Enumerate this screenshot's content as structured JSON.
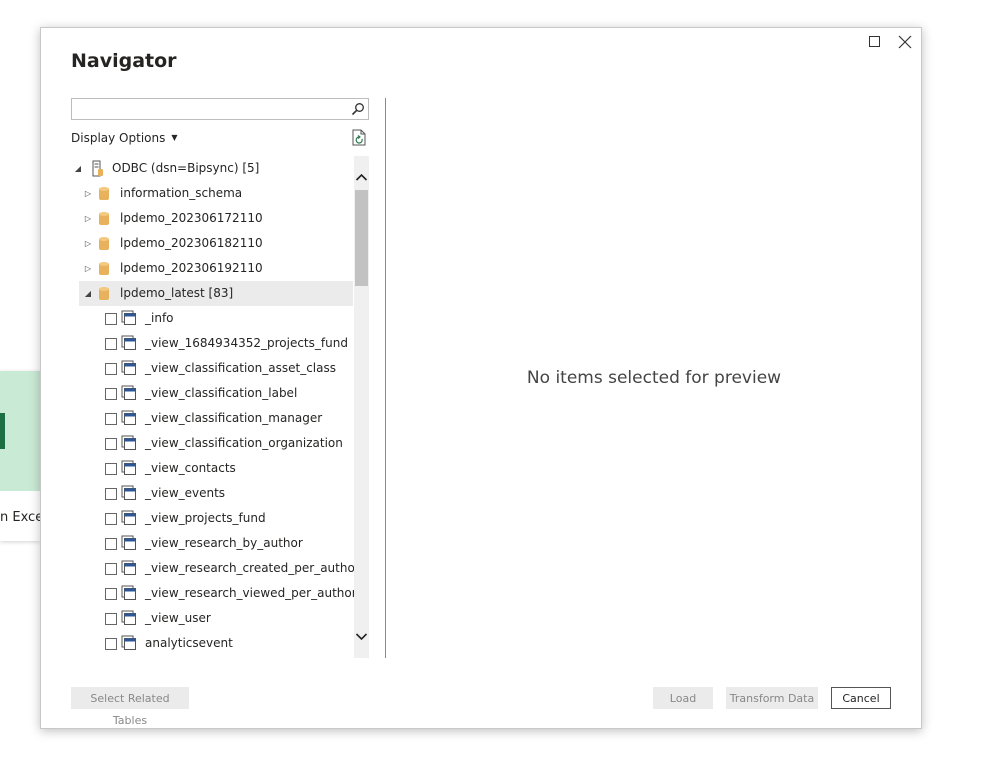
{
  "background": {
    "card_label": "n Excel"
  },
  "dialog": {
    "title": "Navigator",
    "search": {
      "value": "",
      "placeholder": ""
    },
    "display_options_label": "Display Options",
    "preview_empty_text": "No items selected for preview",
    "buttons": {
      "select_related": "Select Related Tables",
      "load": "Load",
      "transform": "Transform Data",
      "cancel": "Cancel"
    }
  },
  "tree": {
    "root": {
      "label": "ODBC (dsn=Bipsync) [5]",
      "expanded": true
    },
    "databases": [
      {
        "label": "information_schema",
        "expanded": false
      },
      {
        "label": "lpdemo_202306172110",
        "expanded": false
      },
      {
        "label": "lpdemo_202306182110",
        "expanded": false
      },
      {
        "label": "lpdemo_202306192110",
        "expanded": false
      },
      {
        "label": "lpdemo_latest [83]",
        "expanded": true
      }
    ],
    "tables": [
      {
        "label": "_info"
      },
      {
        "label": "_view_1684934352_projects_fund"
      },
      {
        "label": "_view_classification_asset_class"
      },
      {
        "label": "_view_classification_label"
      },
      {
        "label": "_view_classification_manager"
      },
      {
        "label": "_view_classification_organization"
      },
      {
        "label": "_view_contacts"
      },
      {
        "label": "_view_events"
      },
      {
        "label": "_view_projects_fund"
      },
      {
        "label": "_view_research_by_author"
      },
      {
        "label": "_view_research_created_per_author"
      },
      {
        "label": "_view_research_viewed_per_author"
      },
      {
        "label": "_view_user"
      },
      {
        "label": "analyticsevent"
      }
    ]
  },
  "colors": {
    "db_icon": "#e8b15c",
    "table_icon": "#2b5797",
    "excel_green": "#1d7044",
    "card_green": "#c9ead5"
  },
  "icons": {
    "search": "search-icon",
    "refresh": "refresh-icon",
    "server": "server-icon",
    "database": "database-icon",
    "table": "table-icon"
  }
}
